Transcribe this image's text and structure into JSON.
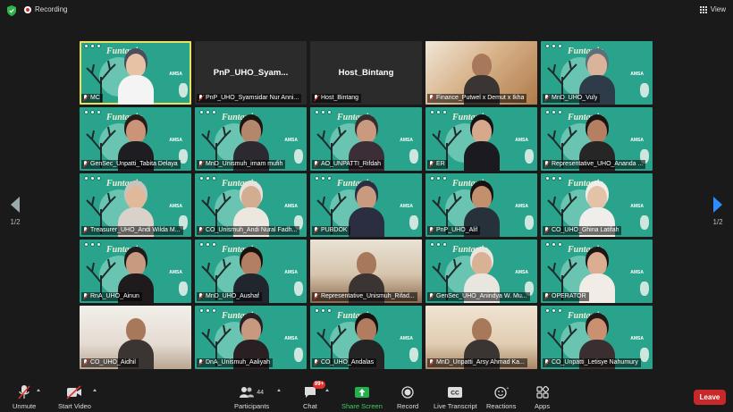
{
  "topbar": {
    "recording_label": "Recording",
    "view_label": "View"
  },
  "pager": {
    "left_label": "1/2",
    "right_label": "1/2"
  },
  "colors": {
    "accent": "#2d8cff",
    "tile_bg": "#2aa38c",
    "active_border": "#e8e35c",
    "leave": "#c8282a"
  },
  "background_art": {
    "title": "Funtastic",
    "badge": "AMSA"
  },
  "tiles": [
    {
      "name": "MC",
      "type": "bg",
      "active": true,
      "skin": "#e8c2a4",
      "hair": "#4a4f5c",
      "shirt": "#f4f4f4"
    },
    {
      "name": "PnP_UHO_Syamsidar Nur Anni...",
      "center": "PnP_UHO_Syam...",
      "type": "dark"
    },
    {
      "name": "Host_Bintang",
      "center": "Host_Bintang",
      "type": "dark"
    },
    {
      "name": "Finance_Putwel x Demut x Ikha",
      "type": "photo",
      "photo": "warm"
    },
    {
      "name": "MnD_UHO_Vuly",
      "type": "bg",
      "skin": "#d9b49a",
      "hair": "#5c6f7a",
      "shirt": "#2e3b48"
    },
    {
      "name": "GenSec_Unpatti_Tabita Delaya",
      "type": "bg",
      "skin": "#c99477",
      "hair": "#2a1c18",
      "shirt": "#1d1d22"
    },
    {
      "name": "MnD_Unismuh_imam mufih",
      "type": "bg",
      "skin": "#b3876b",
      "hair": "#1c1512",
      "shirt": "#2c2a30"
    },
    {
      "name": "AO_UNPATTI_Rifdah",
      "type": "bg",
      "skin": "#c99a80",
      "hair": "#3a2d32",
      "shirt": "#3b2e36"
    },
    {
      "name": "ER",
      "type": "bg",
      "skin": "#d6a98c",
      "hair": "#141216",
      "shirt": "#1a1a20"
    },
    {
      "name": "Representative_UHO_Ananda ...",
      "type": "bg",
      "skin": "#b57f62",
      "hair": "#1b1412",
      "shirt": "#262626"
    },
    {
      "name": "Treasurer_UHO_Andi Wilda M...",
      "type": "bg",
      "skin": "#e0b99b",
      "hair": "#c9c3bd",
      "shirt": "#d8d2cb"
    },
    {
      "name": "CO_Unismuh_Andi Nural Fadh...",
      "type": "bg",
      "skin": "#d3ad92",
      "hair": "#e7e2da",
      "shirt": "#ece8e0"
    },
    {
      "name": "PUBDOK",
      "type": "bg",
      "skin": "#c89b80",
      "hair": "#2b2e40",
      "shirt": "#2b2e40"
    },
    {
      "name": "PnP_UHO_Alif",
      "type": "bg",
      "skin": "#c3906f",
      "hair": "#17120f",
      "shirt": "#27313a"
    },
    {
      "name": "CO_UHO_Ghina Latifah",
      "type": "bg",
      "skin": "#e3c2a8",
      "hair": "#f0eeea",
      "shirt": "#f0eeea"
    },
    {
      "name": "RnA_UHO_Ainun",
      "type": "bg",
      "skin": "#c89a80",
      "hair": "#1f1a1c",
      "shirt": "#1f1a1c"
    },
    {
      "name": "MnD_UHO_Aushaf",
      "type": "bg",
      "skin": "#b37f62",
      "hair": "#18120f",
      "shirt": "#21262e"
    },
    {
      "name": "Representative_Unismuh_Rifad...",
      "type": "photo",
      "photo": "room"
    },
    {
      "name": "GenSec_UHO_Anindya W. Mu...",
      "type": "bg",
      "skin": "#d9b195",
      "hair": "#e9e5df",
      "shirt": "#e9e5df"
    },
    {
      "name": "OPERATOR",
      "type": "bg",
      "skin": "#dcae91",
      "hair": "#1c1614",
      "shirt": "#f2ece6"
    },
    {
      "name": "CO_UHO_Aidhil",
      "type": "photo",
      "photo": "light"
    },
    {
      "name": "DnA_Unismuh_Aaliyah",
      "type": "bg",
      "skin": "#c79a7f",
      "hair": "#2a2024",
      "shirt": "#2a2024"
    },
    {
      "name": "CO_UHO_Andalas",
      "type": "bg",
      "skin": "#b07d61",
      "hair": "#17120f",
      "shirt": "#242424"
    },
    {
      "name": "MnD_Unpatti_Arsy Ahmad Ka...",
      "type": "photo",
      "photo": "wall"
    },
    {
      "name": "CO_Unpatti_Letisye Nahumury",
      "type": "bg",
      "skin": "#c99072",
      "hair": "#221816",
      "shirt": "#3a2e30"
    }
  ],
  "toolbar": {
    "unmute": "Unmute",
    "start_video": "Start Video",
    "participants": "Participants",
    "participants_count": "44",
    "chat": "Chat",
    "chat_badge": "99+",
    "share_screen": "Share Screen",
    "record": "Record",
    "live_transcript": "Live Transcript",
    "reactions": "Reactions",
    "apps": "Apps",
    "leave": "Leave"
  }
}
